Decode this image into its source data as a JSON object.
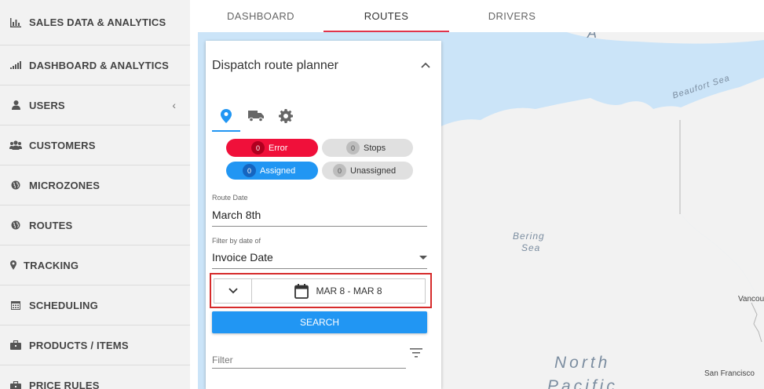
{
  "sidebar": {
    "items": [
      {
        "label": "SALES DATA & ANALYTICS",
        "icon": "bar-chart-icon"
      },
      {
        "label": "DASHBOARD & ANALYTICS",
        "icon": "signal-bars-icon"
      },
      {
        "label": "USERS",
        "icon": "user-icon"
      },
      {
        "label": "CUSTOMERS",
        "icon": "users-group-icon"
      },
      {
        "label": "MICROZONES",
        "icon": "globe-icon"
      },
      {
        "label": "ROUTES",
        "icon": "globe-icon"
      },
      {
        "label": "TRACKING",
        "icon": "map-pin-icon"
      },
      {
        "label": "SCHEDULING",
        "icon": "calendar-icon"
      },
      {
        "label": "PRODUCTS / ITEMS",
        "icon": "briefcase-icon"
      },
      {
        "label": "PRICE RULES",
        "icon": "briefcase-icon"
      }
    ],
    "users_chevron": "‹"
  },
  "tabs": [
    {
      "label": "DASHBOARD"
    },
    {
      "label": "ROUTES",
      "active": true
    },
    {
      "label": "DRIVERS"
    }
  ],
  "map": {
    "labels": {
      "beaufort": "Beaufort Sea",
      "bering": "Bering",
      "sea": "Sea",
      "north": "North",
      "pacific": "Pacific",
      "vancouver": "Vancou",
      "sanfrancisco": "San Francisco",
      "top": "A"
    },
    "colors": {
      "water": "#cbe4f8",
      "land": "#f2f2f2"
    }
  },
  "panel": {
    "title": "Dispatch route planner",
    "chips": {
      "error": {
        "count": "0",
        "label": "Error"
      },
      "stops": {
        "count": "0",
        "label": "Stops"
      },
      "assigned": {
        "count": "0",
        "label": "Assigned"
      },
      "unassigned": {
        "count": "0",
        "label": "Unassigned"
      }
    },
    "route_date": {
      "label": "Route Date",
      "value": "March 8th"
    },
    "filter_by": {
      "label": "Filter by date of",
      "value": "Invoice Date"
    },
    "date_range": "MAR 8 - MAR 8",
    "search_label": "SEARCH",
    "filter_placeholder": "Filter"
  },
  "colors": {
    "accent": "#2196f3",
    "active_tab": "#e0334a",
    "error": "#f0103a"
  }
}
